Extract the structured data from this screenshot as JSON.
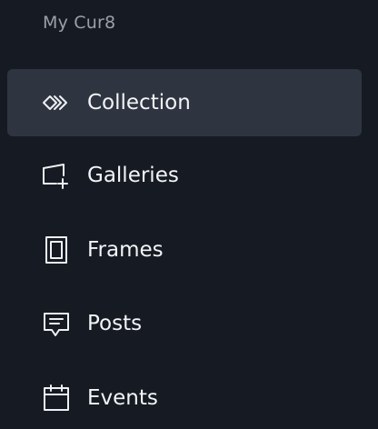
{
  "sidebar": {
    "title": "My Cur8",
    "items": [
      {
        "label": "Collection",
        "icon": "chevrons-right-icon",
        "active": true
      },
      {
        "label": "Galleries",
        "icon": "gallery-add-icon",
        "active": false
      },
      {
        "label": "Frames",
        "icon": "frame-icon",
        "active": false
      },
      {
        "label": "Posts",
        "icon": "message-icon",
        "active": false
      },
      {
        "label": "Events",
        "icon": "calendar-icon",
        "active": false
      }
    ]
  },
  "colors": {
    "background": "#161a22",
    "active_item_background": "#2f3540",
    "label_text": "#f2f4f7",
    "title_text": "#9aa0aa"
  }
}
